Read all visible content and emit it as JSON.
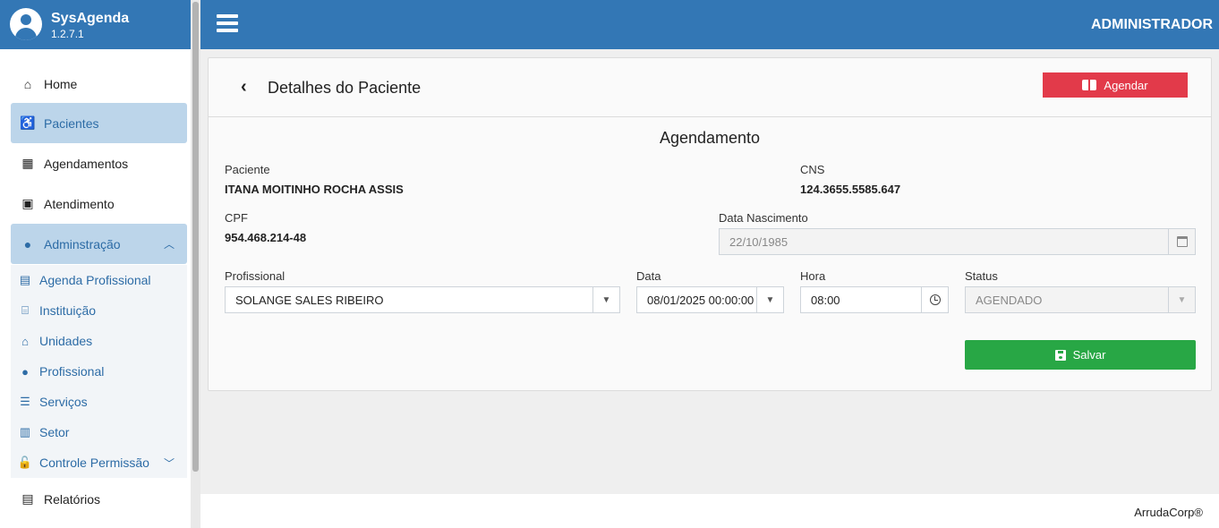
{
  "brand": {
    "name": "SysAgenda",
    "version": "1.2.7.1"
  },
  "topbar": {
    "user": "ADMINISTRADOR"
  },
  "sidebar": {
    "items": [
      {
        "label": "Home"
      },
      {
        "label": "Pacientes"
      },
      {
        "label": "Agendamentos"
      },
      {
        "label": "Atendimento"
      },
      {
        "label": "Adminstração"
      }
    ],
    "admin_sub": [
      {
        "label": "Agenda Profissional"
      },
      {
        "label": "Instituição"
      },
      {
        "label": "Unidades"
      },
      {
        "label": "Profissional"
      },
      {
        "label": "Serviços"
      },
      {
        "label": "Setor"
      },
      {
        "label": "Controle Permissão"
      }
    ],
    "reports": {
      "label": "Relatórios"
    }
  },
  "page": {
    "title": "Detalhes do Paciente",
    "agendar_label": "Agendar",
    "section_title": "Agendamento",
    "paciente_label": "Paciente",
    "paciente_value": "ITANA MOITINHO ROCHA ASSIS",
    "cns_label": "CNS",
    "cns_value": "124.3655.5585.647",
    "cpf_label": "CPF",
    "cpf_value": "954.468.214-48",
    "nascimento_label": "Data Nascimento",
    "nascimento_value": "22/10/1985",
    "profissional_label": "Profissional",
    "profissional_value": "SOLANGE SALES RIBEIRO",
    "data_label": "Data",
    "data_value": "08/01/2025 00:00:00",
    "hora_label": "Hora",
    "hora_value": "08:00",
    "status_label": "Status",
    "status_value": "AGENDADO",
    "salvar_label": "Salvar"
  },
  "footer": {
    "copyright": "ArrudaCorp®"
  },
  "colors": {
    "primary": "#3377b5",
    "danger": "#e23a4a",
    "success": "#28a745",
    "active_bg": "#bcd5ea"
  }
}
